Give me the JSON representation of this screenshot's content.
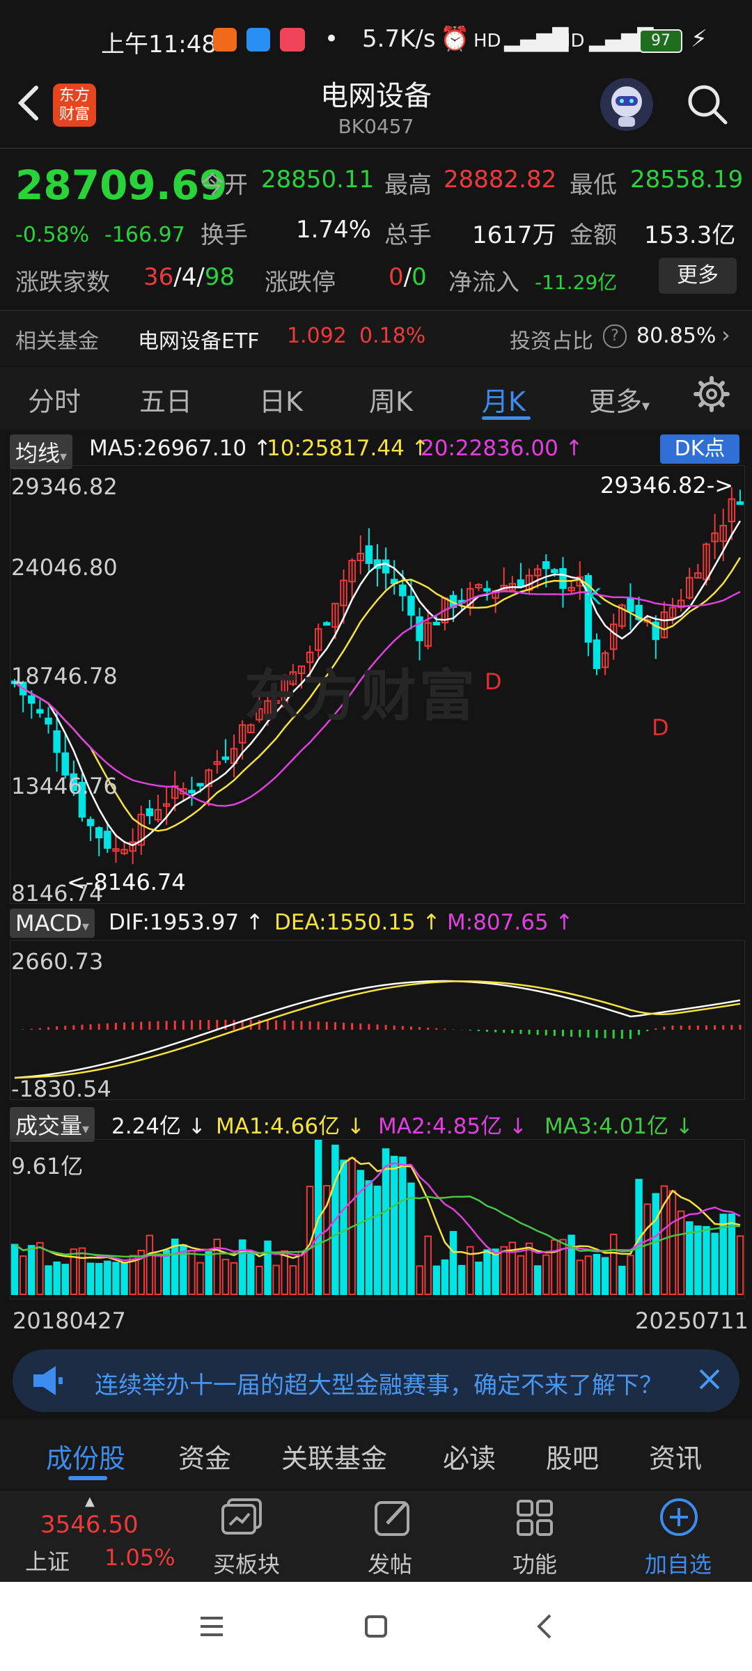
{
  "status_bar": {
    "time": "上午11:48",
    "speed": "5.7K/s",
    "battery": "97"
  },
  "header": {
    "title": "电网设备",
    "code": "BK0457",
    "logo_text_1": "东方",
    "logo_text_2": "财富"
  },
  "quote": {
    "price": "28709.69",
    "change_pct": "-0.58%",
    "change": "-166.97",
    "open_label": "今开",
    "open": "28850.11",
    "high_label": "最高",
    "high": "28882.82",
    "low_label": "最低",
    "low": "28558.19",
    "turnover_label": "换手",
    "turnover": "1.74%",
    "volume_label": "总手",
    "volume": "1617万",
    "amount_label": "金额",
    "amount": "153.3亿",
    "breadth_label": "涨跌家数",
    "up_count": "36",
    "flat_count": "4",
    "down_count": "98",
    "limit_label": "涨跌停",
    "limit_up": "0",
    "limit_down": "0",
    "netflow_label": "净流入",
    "netflow": "-11.29亿",
    "more_button": "更多"
  },
  "fund": {
    "label": "相关基金",
    "name": "电网设备ETF",
    "price": "1.092",
    "pct": "0.18%",
    "ratio_label": "投资占比",
    "ratio": "80.85%"
  },
  "period_tabs": [
    "分时",
    "五日",
    "日K",
    "周K",
    "月K",
    "更多"
  ],
  "active_period": "月K",
  "kline": {
    "indicator_label": "均线",
    "ma5": "MA5:26967.10",
    "ma10": "10:25817.44",
    "ma20": "20:22836.00",
    "dk_button": "DK点",
    "y_labels": [
      "29346.82",
      "24046.80",
      "18746.78",
      "13446.76",
      "8146.74"
    ],
    "max_marker": "29346.82->",
    "min_marker": "<-8146.74",
    "watermark": "东方财富",
    "td_labels": {
      "d1": "D",
      "d2": "D",
      "k": "K"
    }
  },
  "macd": {
    "label": "MACD",
    "dif": "DIF:1953.97",
    "dea": "DEA:1550.15",
    "m": "M:807.65",
    "top": "2660.73",
    "bottom": "-1830.54"
  },
  "volume_panel": {
    "label": "成交量",
    "value": "2.24亿",
    "ma1": "MA1:4.66亿",
    "ma2": "MA2:4.85亿",
    "ma3": "MA3:4.01亿",
    "top": "9.61亿",
    "start_date": "20180427",
    "end_date": "20250711"
  },
  "banner": {
    "text": "连续举办十一届的超大型金融赛事，确定不来了解下？"
  },
  "content_tabs": [
    "成份股",
    "资金",
    "关联基金",
    "必读",
    "股吧",
    "资讯"
  ],
  "bottom_bar": {
    "index_value": "3546.50",
    "index_name": "上证",
    "index_pct": "1.05%",
    "items": [
      "买板块",
      "发帖",
      "功能",
      "加自选"
    ]
  },
  "colors": {
    "up": "#ee3a3a",
    "down": "#00e4e4",
    "accent": "#3d8cf0"
  }
}
